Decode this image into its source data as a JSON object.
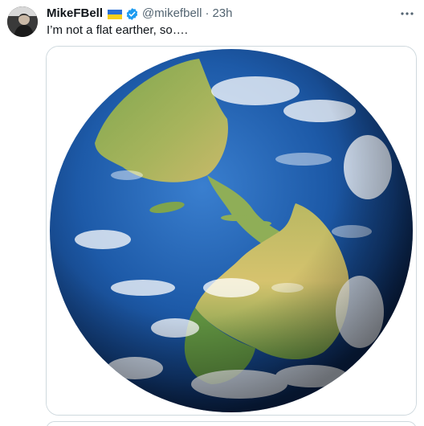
{
  "post": {
    "display_name": "MikeFBell",
    "handle": "@mikefbell",
    "separator": "·",
    "time": "23h",
    "text": "I’m not a flat earther, so…."
  },
  "icons": {
    "flag": "ukraine-flag-icon",
    "verified": "verified-badge-icon",
    "more": "more-options-icon"
  },
  "colors": {
    "verified": "#1d9bf0",
    "text_primary": "#0f1419",
    "text_secondary": "#536471",
    "ocean": "#1c4f96",
    "land": "#6f9a45"
  }
}
